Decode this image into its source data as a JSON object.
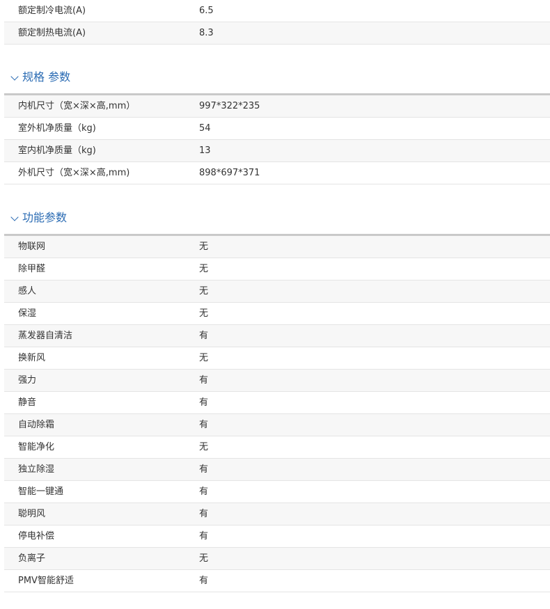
{
  "top_rows": [
    {
      "label": "额定制冷电流(A)",
      "value": "6.5"
    },
    {
      "label": "额定制热电流(A)",
      "value": "8.3"
    }
  ],
  "spec_section": {
    "title": "规格 参数",
    "rows": [
      {
        "label": "内机尺寸（宽×深×高,mm）",
        "value": "997*322*235"
      },
      {
        "label": "室外机净质量（kg)",
        "value": "54"
      },
      {
        "label": "室内机净质量（kg)",
        "value": "13"
      },
      {
        "label": "外机尺寸（宽×深×高,mm)",
        "value": "898*697*371"
      }
    ]
  },
  "func_section": {
    "title": "功能参数",
    "rows": [
      {
        "label": "物联网",
        "value": "无"
      },
      {
        "label": "除甲醛",
        "value": "无"
      },
      {
        "label": "感人",
        "value": "无"
      },
      {
        "label": "保湿",
        "value": "无"
      },
      {
        "label": "蒸发器自清洁",
        "value": "有"
      },
      {
        "label": "换新风",
        "value": "无"
      },
      {
        "label": "强力",
        "value": "有"
      },
      {
        "label": "静音",
        "value": "有"
      },
      {
        "label": "自动除霜",
        "value": "有"
      },
      {
        "label": "智能净化",
        "value": "无"
      },
      {
        "label": "独立除湿",
        "value": "有"
      },
      {
        "label": "智能一键通",
        "value": "有"
      },
      {
        "label": "聪明风",
        "value": "有"
      },
      {
        "label": "停电补偿",
        "value": "有"
      },
      {
        "label": "负离子",
        "value": "无"
      },
      {
        "label": "PMV智能舒适",
        "value": "有"
      }
    ]
  }
}
